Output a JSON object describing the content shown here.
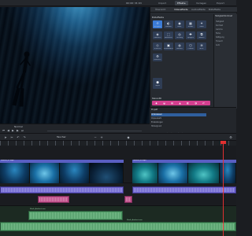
{
  "titlebar": {
    "timecode": "00:00:35:03",
    "tabs": [
      "Import",
      "Effekte",
      "Vorlagen",
      "Export"
    ],
    "active_tab": 1
  },
  "player": {
    "label": "Normal",
    "controls": [
      "skip-back-icon",
      "prev-icon",
      "play-icon",
      "next-icon",
      "skip-forward-icon"
    ]
  },
  "effects": {
    "tabs": [
      "Übersicht",
      "Videoeffekte",
      "Audioeffekte",
      "Bildeffekte",
      "Intro/Outro"
    ],
    "active_tab": 1,
    "section_title": "Bildeffekte",
    "tiles": [
      {
        "icon": "☼",
        "label": "Helligkeit"
      },
      {
        "icon": "◐",
        "label": "Kontrast"
      },
      {
        "icon": "◉",
        "label": "Farbe"
      },
      {
        "icon": "▦",
        "label": "Schärfe"
      },
      {
        "icon": "✦",
        "label": "Glanz"
      },
      {
        "icon": "◈",
        "label": "Rauschen"
      },
      {
        "icon": "⬚",
        "label": "Ausschnitt"
      },
      {
        "icon": "◎",
        "label": "Drehung"
      },
      {
        "icon": "✚",
        "label": "Spiegeln"
      },
      {
        "icon": "⧉",
        "label": "Masken"
      },
      {
        "icon": "◇",
        "label": "Verzerren"
      },
      {
        "icon": "▣",
        "label": "Schwarzweiß"
      },
      {
        "icon": "◍",
        "label": "Rahmen"
      },
      {
        "icon": "⬡",
        "label": "Chroma"
      },
      {
        "icon": "≋",
        "label": "Welle"
      },
      {
        "icon": "⚙",
        "label": "Einstellen"
      },
      {
        "icon": "⬢",
        "label": "Objekt"
      }
    ],
    "right_title": "Helligkeit/Kontrast",
    "right_rows": [
      "Helligkeit",
      "Kontrast",
      "Gamma",
      "Farbe",
      "Sättigung",
      "Tonwert",
      "Auto"
    ],
    "bottom_title": "Stereo3D"
  },
  "media_pool": {
    "title": "Projekt",
    "rows": [
      "Unterwasser",
      "Clipauswahl",
      "Einstellungen",
      "Hintergrund"
    ],
    "selected": 0,
    "path": "D:\\Videos\\Unterwasser\\Projekt\\Clips\\Taucher_01.mp4"
  },
  "timeline": {
    "title": "Taucher",
    "clip_names": [
      "Taucher_01.mp4",
      "Taucher_02.mp4"
    ],
    "audio_labels": [
      "Musik_Ambient.wav",
      "Musik_Ambient.wav",
      "Atmo.wav"
    ]
  },
  "colors": {
    "accent": "#3b7bd6",
    "clip_video": "#5a5fc2",
    "clip_audio": "#6f66d1",
    "clip_pink": "#c04f8a",
    "clip_green": "#4f9a66",
    "playhead": "#e03030"
  }
}
